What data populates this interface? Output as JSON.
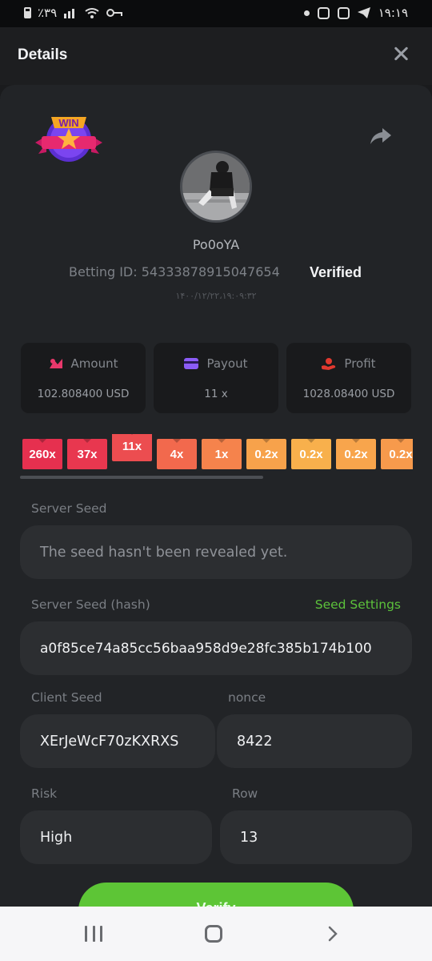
{
  "status_bar": {
    "time": "۱۹:۱۹",
    "battery": "٪۳۹"
  },
  "header": {
    "title": "Details"
  },
  "bet": {
    "username": "Po0oYA",
    "betting_id_label": "Betting ID: 54333878915047654",
    "verified": "Verified",
    "datetime": "۱۴۰۰/۱۲/۲۲،۱۹:۰۹:۳۲"
  },
  "stats": [
    {
      "label": "Amount",
      "value": "102.808400 USD",
      "icon": "amount-icon",
      "color": "#e8386b"
    },
    {
      "label": "Payout",
      "value": "11 x",
      "icon": "payout-icon",
      "color": "#8b5cf6"
    },
    {
      "label": "Profit",
      "value": "1028.08400 USD",
      "icon": "profit-icon",
      "color": "#e2392f"
    }
  ],
  "multipliers": [
    {
      "label": "260x",
      "color": "#e6304f",
      "hit": false
    },
    {
      "label": "37x",
      "color": "#e8374f",
      "hit": false
    },
    {
      "label": "11x",
      "color": "#ec4d50",
      "hit": true
    },
    {
      "label": "4x",
      "color": "#f2694d",
      "hit": false
    },
    {
      "label": "1x",
      "color": "#f5834c",
      "hit": false
    },
    {
      "label": "0.2x",
      "color": "#f7a24b",
      "hit": false
    },
    {
      "label": "0.2x",
      "color": "#f8b04c",
      "hit": false
    },
    {
      "label": "0.2x",
      "color": "#f8a54c",
      "hit": false
    },
    {
      "label": "0.2x",
      "color": "#f79a4c",
      "hit": false
    }
  ],
  "seeds": {
    "server_seed_label": "Server Seed",
    "server_seed_value": "The seed hasn't been revealed yet.",
    "server_hash_label": "Server Seed (hash)",
    "seed_settings_link": "Seed Settings",
    "server_hash_value": "a0f85ce74a85cc56baa958d9e28fc385b174b100",
    "client_seed_label": "Client Seed",
    "client_seed_value": "XErJeWcF70zKXRXS",
    "nonce_label": "nonce",
    "nonce_value": "8422",
    "risk_label": "Risk",
    "risk_value": "High",
    "row_label": "Row",
    "row_value": "13"
  },
  "verify_button": {
    "label": "Verify"
  },
  "colors": {
    "accent": "#5dc536",
    "background": "#222427"
  }
}
